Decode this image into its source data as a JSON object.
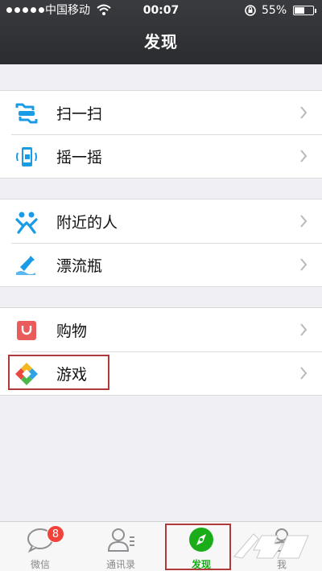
{
  "status": {
    "carrier": "中国移动",
    "time": "00:07",
    "battery": "55%",
    "battery_level": 0.55
  },
  "nav": {
    "title": "发现"
  },
  "groups": [
    {
      "items": [
        {
          "label": "扫一扫",
          "icon": "scan-icon"
        },
        {
          "label": "摇一摇",
          "icon": "shake-icon"
        }
      ]
    },
    {
      "items": [
        {
          "label": "附近的人",
          "icon": "people-nearby-icon"
        },
        {
          "label": "漂流瓶",
          "icon": "drift-bottle-icon"
        }
      ]
    },
    {
      "items": [
        {
          "label": "购物",
          "icon": "shopping-icon"
        },
        {
          "label": "游戏",
          "icon": "game-icon"
        }
      ]
    }
  ],
  "tabs": [
    {
      "label": "微信",
      "badge": "8",
      "icon": "chat-bubble-icon"
    },
    {
      "label": "通讯录",
      "icon": "contacts-icon"
    },
    {
      "label": "发现",
      "icon": "compass-icon",
      "active": true
    },
    {
      "label": "我",
      "icon": "person-icon"
    }
  ],
  "colors": {
    "accent": "#1aad19",
    "badge": "#f0433a",
    "highlight": "#b03a3a",
    "nav_bg": "#2b2c30"
  }
}
